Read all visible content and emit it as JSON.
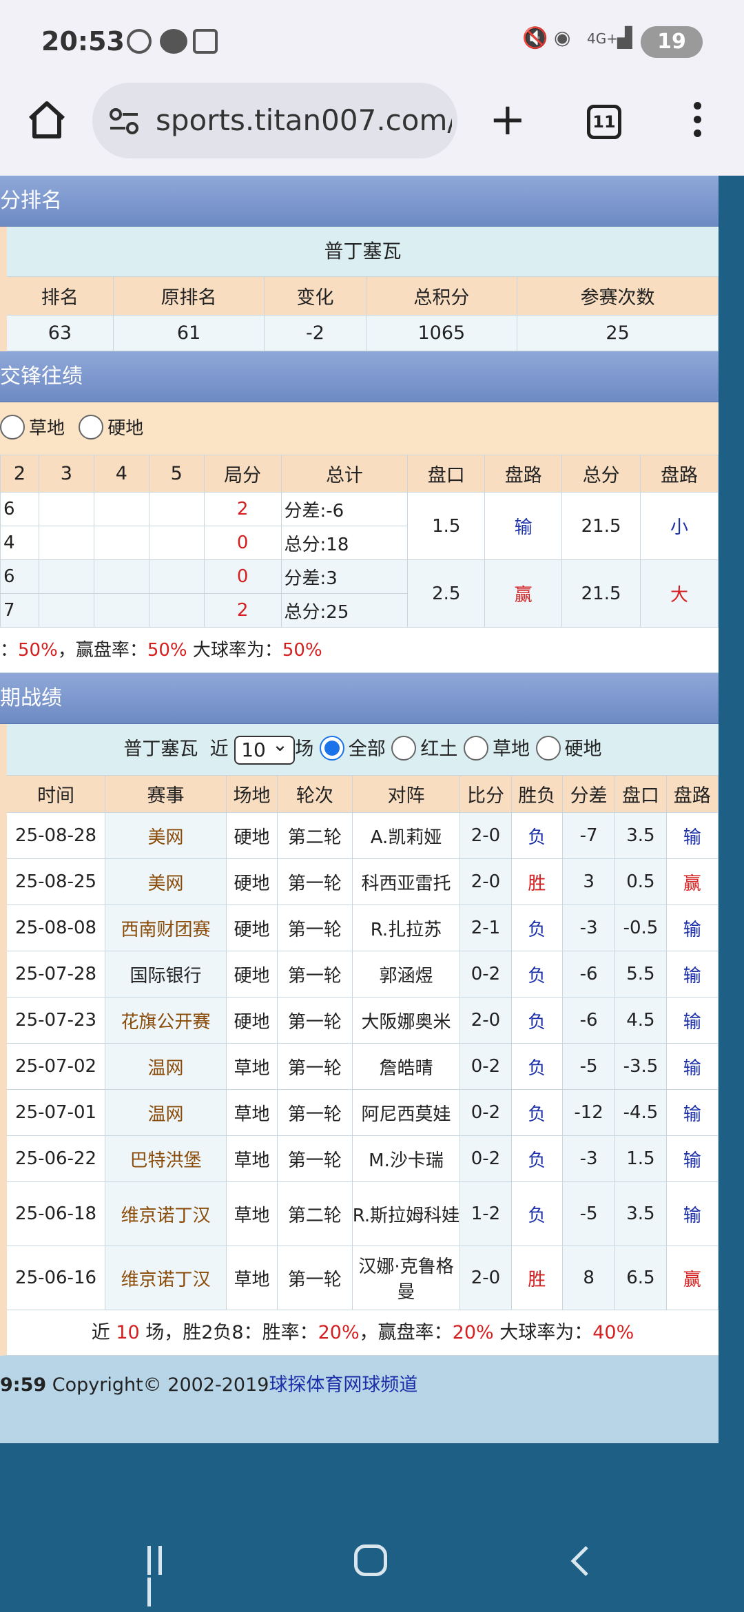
{
  "status": {
    "time": "20:53",
    "network": "4G+",
    "battery": "19"
  },
  "browser": {
    "url": "sports.titan007.com/",
    "tab_count": "11"
  },
  "ranking": {
    "section_title": "分排名",
    "player": "普丁塞瓦",
    "headers": [
      "排名",
      "原排名",
      "变化",
      "总积分",
      "参赛次数"
    ],
    "values": [
      "63",
      "61",
      "-2",
      "1065",
      "25"
    ]
  },
  "h2h": {
    "section_title": "交锋往绩",
    "filters": [
      "草地",
      "硬地"
    ],
    "headers": [
      "2",
      "3",
      "4",
      "5",
      "局分",
      "总计",
      "盘口",
      "盘路",
      "总分",
      "盘路"
    ],
    "matches": [
      {
        "rows": [
          {
            "s2": "6",
            "set_score": "2",
            "total": "分差:-6"
          },
          {
            "s2": "4",
            "set_score": "0",
            "total": "总分:18"
          }
        ],
        "handicap": "1.5",
        "result": "输",
        "total_pts": "21.5",
        "ou": "小"
      },
      {
        "rows": [
          {
            "s2": "6",
            "set_score": "0",
            "total": "分差:3"
          },
          {
            "s2": "7",
            "set_score": "2",
            "total": "总分:25"
          }
        ],
        "handicap": "2.5",
        "result": "赢",
        "total_pts": "21.5",
        "ou": "大"
      }
    ],
    "summary": {
      "p1": "：",
      "v1": "50%",
      "p2": "，赢盘率：",
      "v2": "50%",
      "p3": " 大球率为：",
      "v3": "50%"
    }
  },
  "recent": {
    "section_title": "期战绩",
    "player": "普丁塞瓦",
    "near_label": "近",
    "count_value": "10",
    "count_unit": "场",
    "filters": [
      "全部",
      "红土",
      "草地",
      "硬地"
    ],
    "headers": [
      "时间",
      "赛事",
      "场地",
      "轮次",
      "对阵",
      "比分",
      "胜负",
      "分差",
      "盘口",
      "盘路"
    ],
    "rows": [
      {
        "date": "25-08-28",
        "event": "美网",
        "surface": "硬地",
        "round": "第二轮",
        "opponent": "A.凯莉娅",
        "score": "2-0",
        "wl": "负",
        "diff": "-7",
        "line": "3.5",
        "ah": "输"
      },
      {
        "date": "25-08-25",
        "event": "美网",
        "surface": "硬地",
        "round": "第一轮",
        "opponent": "科西亚雷托",
        "score": "2-0",
        "wl": "胜",
        "diff": "3",
        "line": "0.5",
        "ah": "赢"
      },
      {
        "date": "25-08-08",
        "event": "西南财团赛",
        "surface": "硬地",
        "round": "第一轮",
        "opponent": "R.扎拉苏",
        "score": "2-1",
        "wl": "负",
        "diff": "-3",
        "line": "-0.5",
        "ah": "输"
      },
      {
        "date": "25-07-28",
        "event": "国际银行",
        "surface": "硬地",
        "round": "第一轮",
        "opponent": "郭涵煜",
        "score": "0-2",
        "wl": "负",
        "diff": "-6",
        "line": "5.5",
        "ah": "输"
      },
      {
        "date": "25-07-23",
        "event": "花旗公开赛",
        "surface": "硬地",
        "round": "第一轮",
        "opponent": "大阪娜奥米",
        "score": "2-0",
        "wl": "负",
        "diff": "-6",
        "line": "4.5",
        "ah": "输"
      },
      {
        "date": "25-07-02",
        "event": "温网",
        "surface": "草地",
        "round": "第一轮",
        "opponent": "詹皓晴",
        "score": "0-2",
        "wl": "负",
        "diff": "-5",
        "line": "-3.5",
        "ah": "输"
      },
      {
        "date": "25-07-01",
        "event": "温网",
        "surface": "草地",
        "round": "第一轮",
        "opponent": "阿尼西莫娃",
        "score": "0-2",
        "wl": "负",
        "diff": "-12",
        "line": "-4.5",
        "ah": "输"
      },
      {
        "date": "25-06-22",
        "event": "巴特洪堡",
        "surface": "草地",
        "round": "第一轮",
        "opponent": "M.沙卡瑞",
        "score": "0-2",
        "wl": "负",
        "diff": "-3",
        "line": "1.5",
        "ah": "输"
      },
      {
        "date": "25-06-18",
        "event": "维京诺丁汉",
        "surface": "草地",
        "round": "第二轮",
        "opponent": "R.斯拉姆科娃",
        "score": "1-2",
        "wl": "负",
        "diff": "-5",
        "line": "3.5",
        "ah": "输"
      },
      {
        "date": "25-06-16",
        "event": "维京诺丁汉",
        "surface": "草地",
        "round": "第一轮",
        "opponent": "汉娜·克鲁格曼",
        "score": "2-0",
        "wl": "胜",
        "diff": "8",
        "line": "6.5",
        "ah": "赢"
      }
    ],
    "summary": {
      "t1": "近 ",
      "n": "10",
      "t2": " 场，胜2负8：胜率：",
      "v1": "20%",
      "t3": "，赢盘率：",
      "v2": "20%",
      "t4": " 大球率为：",
      "v3": "40%"
    }
  },
  "footer": {
    "time": "9:59",
    "copyright": " Copyright© 2002-2019",
    "link": "球探体育网球频道"
  },
  "colors": {
    "header_gradient": "#7b96cf",
    "row_tint": "#eef6fa",
    "header_tint": "#f9ddc1",
    "win": "#d42020",
    "loss": "#1b2fa8",
    "event": "#8a4b08"
  }
}
